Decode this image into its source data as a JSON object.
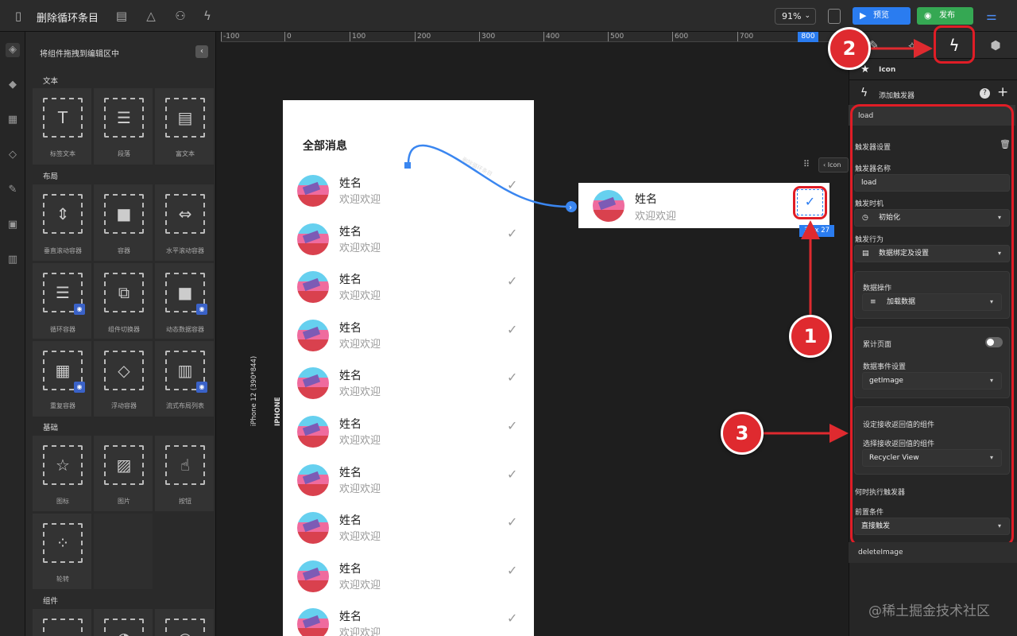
{
  "topbar": {
    "title": "删除循环条目",
    "zoom": "91%",
    "preview_label": "预览",
    "publish_label": "发布"
  },
  "panel": {
    "title": "将组件拖拽到编辑区中",
    "sections": {
      "text": "文本",
      "layout": "布局",
      "basic": "基础",
      "components": "组件"
    },
    "text_items": [
      "标签文本",
      "段落",
      "富文本"
    ],
    "layout_items": [
      "垂直滚动容器",
      "容器",
      "水平滚动容器",
      "循环容器",
      "组件切换器",
      "动态数据容器",
      "重复容器",
      "浮动容器",
      "流式布局列表"
    ],
    "basic_items": [
      "图标",
      "图片",
      "按钮",
      "轮转"
    ]
  },
  "ruler": {
    "ticks": [
      "-100",
      "0",
      "100",
      "200",
      "300",
      "400",
      "500",
      "600",
      "700",
      "800"
    ]
  },
  "canvas": {
    "device_label": "iPhone 12 (390*844)",
    "device_type": "IPHONE",
    "connector_label": "删除循环条目",
    "size_badge": "31 x 27",
    "sel_crumb": "Icon"
  },
  "phone": {
    "title": "全部消息",
    "rows": [
      {
        "name": "姓名",
        "sub": "欢迎欢迎"
      },
      {
        "name": "姓名",
        "sub": "欢迎欢迎"
      },
      {
        "name": "姓名",
        "sub": "欢迎欢迎"
      },
      {
        "name": "姓名",
        "sub": "欢迎欢迎"
      },
      {
        "name": "姓名",
        "sub": "欢迎欢迎"
      },
      {
        "name": "姓名",
        "sub": "欢迎欢迎"
      },
      {
        "name": "姓名",
        "sub": "欢迎欢迎"
      },
      {
        "name": "姓名",
        "sub": "欢迎欢迎"
      },
      {
        "name": "姓名",
        "sub": "欢迎欢迎"
      },
      {
        "name": "姓名",
        "sub": "欢迎欢迎"
      }
    ]
  },
  "selected": {
    "name": "姓名",
    "sub": "欢迎欢迎"
  },
  "annotations": [
    "1",
    "2",
    "3"
  ],
  "right": {
    "component": "Icon",
    "add_trigger": "添加触发器",
    "trigger_tab": "load",
    "trigger_settings": "触发器设置",
    "trigger_name_label": "触发器名称",
    "trigger_name_value": "load",
    "trigger_time_label": "触发时机",
    "trigger_time_value": "初始化",
    "trigger_action_label": "触发行为",
    "trigger_action_value": "数据绑定及设置",
    "data_op_label": "数据操作",
    "data_op_value": "加载数据",
    "accumulate_label": "累计页面",
    "data_event_label": "数据事件设置",
    "data_event_value": "getImage",
    "return_comp_label": "设定接收返回值的组件",
    "select_return_label": "选择接收返回值的组件",
    "select_return_value": "Recycler View",
    "when_label": "何时执行触发器",
    "precondition_label": "前置条件",
    "precondition_value": "直接触发",
    "other_trigger": "deleteImage"
  },
  "watermark": "@稀土掘金技术社区",
  "colors": {
    "accent": "#2a7cf0",
    "publish": "#35a853",
    "annotation": "#df2a2f"
  }
}
